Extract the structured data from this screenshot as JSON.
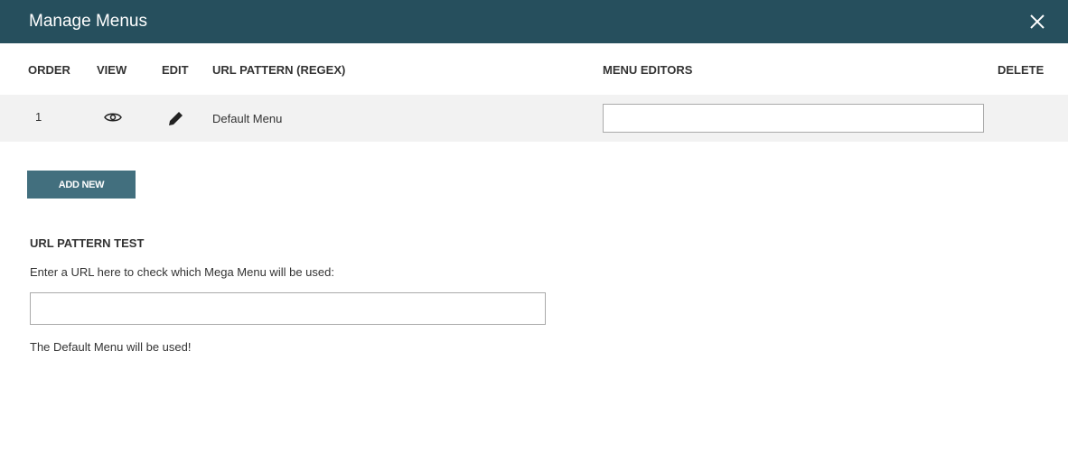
{
  "header": {
    "title": "Manage Menus",
    "close_icon": "close-icon"
  },
  "table": {
    "columns": [
      "ORDER",
      "VIEW",
      "EDIT",
      "URL PATTERN (REGEX)",
      "MENU EDITORS",
      "DELETE"
    ],
    "rows": [
      {
        "order": "1",
        "view_icon": "eye-icon",
        "edit_icon": "pencil-icon",
        "url_pattern": "Default Menu",
        "menu_editors": ""
      }
    ]
  },
  "add_new_label": "ADD NEW",
  "test": {
    "heading": "URL PATTERN TEST",
    "label": "Enter a URL here to check which Mega Menu will be used:",
    "value": "",
    "result": "The Default Menu will be used!"
  }
}
